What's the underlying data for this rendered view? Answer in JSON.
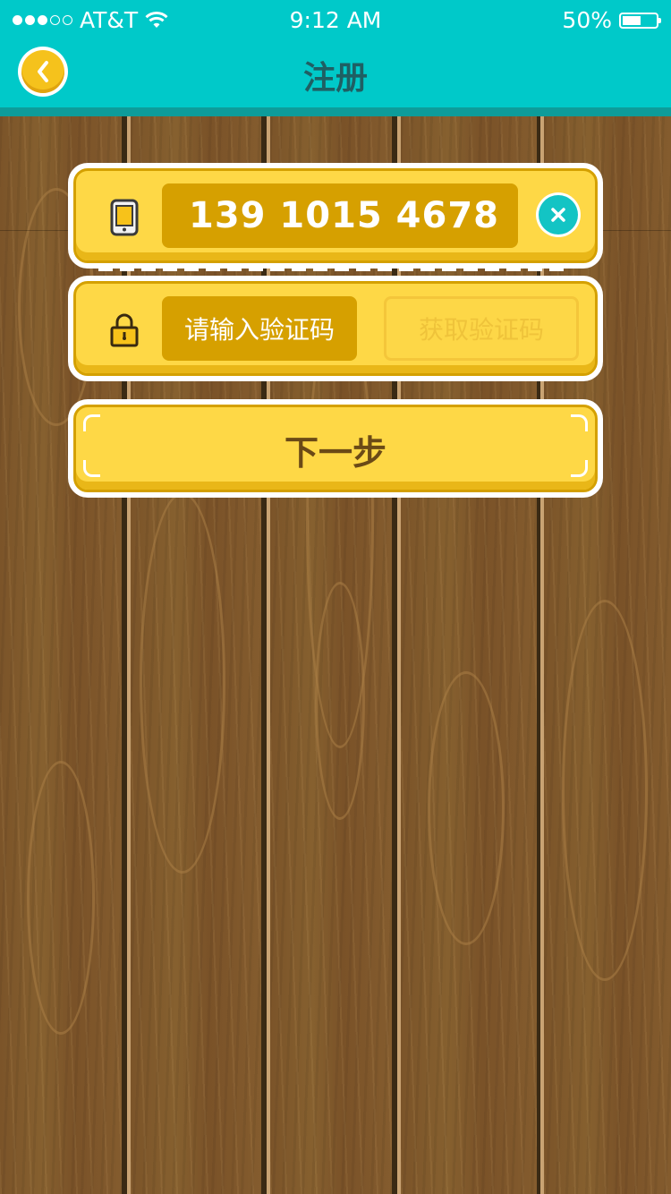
{
  "status_bar": {
    "carrier": "AT&T",
    "time": "9:12 AM",
    "battery_percent": "50%",
    "battery_level": 0.5,
    "signal_bars_filled": 3,
    "signal_bars_total": 5
  },
  "header": {
    "title": "注册",
    "back_icon": "chevron-left-icon"
  },
  "phone_field": {
    "icon": "phone-icon",
    "value": "139 1015 4678",
    "clear_icon": "close-icon"
  },
  "code_field": {
    "icon": "lock-icon",
    "placeholder": "请输入验证码",
    "get_code_label": "获取验证码"
  },
  "next_button": {
    "label": "下一步"
  },
  "colors": {
    "header_bg": "#00c9c9",
    "card_yellow": "#fed846",
    "input_dark_yellow": "#d6a000",
    "clear_teal": "#13c4c4",
    "wood": "#7a5328"
  }
}
